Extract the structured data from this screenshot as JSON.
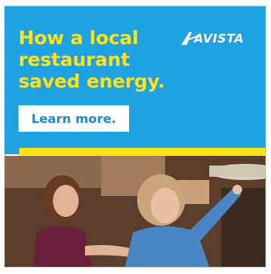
{
  "ad": {
    "headline": [
      "How a local",
      "restaurant",
      "saved energy."
    ],
    "cta_label": "Learn more.",
    "brand": "AVISTA",
    "photo_description_icon": "restaurant-scene-illustration"
  },
  "colors": {
    "panel_blue": "#1ea2e2",
    "headline_yellow": "#ffe31a",
    "cta_text_blue": "#1c8ac9",
    "stripe_yellow": "#ffe31a"
  }
}
